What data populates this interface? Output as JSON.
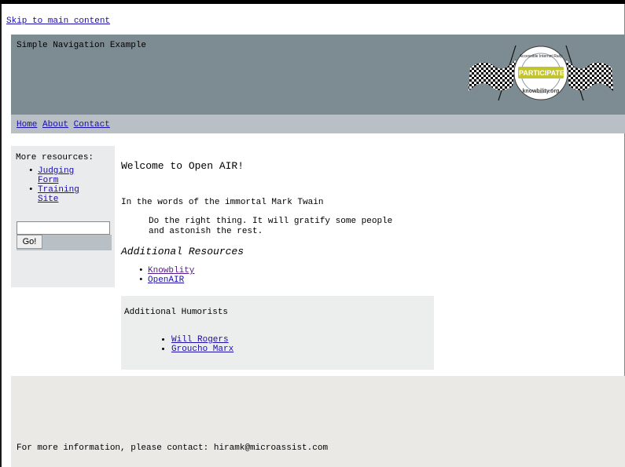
{
  "skip_link": "Skip to main content",
  "header": {
    "title": "Simple Navigation Example",
    "logo": {
      "icon": "checkered-flags-logo-icon",
      "badge_text": "I PARTICIPATE!",
      "ring_text": "Accessible Internet Rally",
      "brand_text": "knowbility.org"
    }
  },
  "nav": {
    "items": [
      "Home",
      "About",
      "Contact"
    ]
  },
  "sidebar": {
    "title": "More resources:",
    "links": [
      {
        "line1": "Judging",
        "line2": "Form"
      },
      {
        "line1": "Training",
        "line2": "Site"
      }
    ],
    "search": {
      "value": "",
      "button_label": "Go!"
    }
  },
  "main": {
    "welcome": "Welcome to Open AIR!",
    "intro": "In the words of the immortal Mark Twain",
    "quote": "Do the right thing. It will gratify some people and astonish the rest.",
    "additional_heading": "Additional Resources",
    "resources": [
      "Knowblity",
      "OpenAIR"
    ]
  },
  "humorists": {
    "title": "Additional Humorists",
    "links": [
      "Will Rogers",
      "Groucho Marx"
    ]
  },
  "footer": {
    "text": "For more information, please contact: hiramk@microassist.com"
  },
  "colors": {
    "header_bg": "#7d8b93",
    "nav_bg": "#b8c0c6",
    "sidebar_bg": "#e9ebec",
    "panel_bg": "#eceded",
    "footer_bg": "#eae9e5",
    "link": "#1a0dab",
    "visited_link": "#551a8b"
  }
}
